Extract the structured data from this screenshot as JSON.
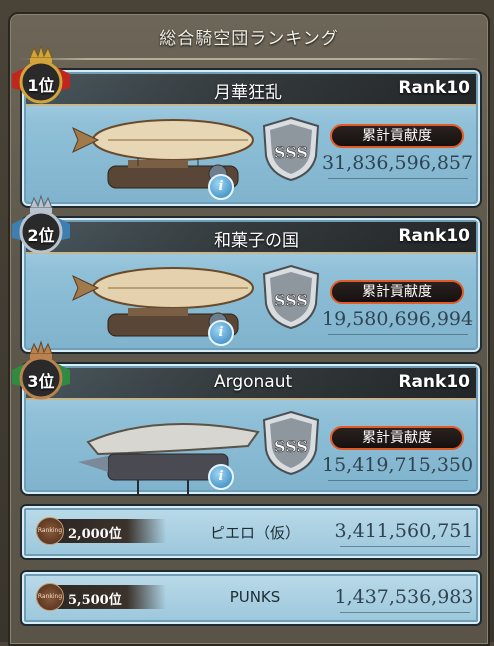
{
  "header": {
    "title": "総合騎空団ランキング"
  },
  "labels": {
    "contribution_badge": "累計貢献度",
    "grade": "SSS",
    "info_glyph": "i",
    "ranking_emblem": "Ranking"
  },
  "top_crews": [
    {
      "position": "1位",
      "name": "月華狂乱",
      "rank": "Rank10",
      "score": "31,836,596,857",
      "medal_color": "#d2a53a",
      "medal_ribbon": "#c0261e"
    },
    {
      "position": "2位",
      "name": "和菓子の国",
      "rank": "Rank10",
      "score": "19,580,696,994",
      "medal_color": "#b8c3cf",
      "medal_ribbon": "#3d7fb0"
    },
    {
      "position": "3位",
      "name": "Argonaut",
      "rank": "Rank10",
      "score": "15,419,715,350",
      "medal_color": "#b9824f",
      "medal_ribbon": "#2e8b3f"
    }
  ],
  "other_crews": [
    {
      "position": "2,000位",
      "name": "ピエロ（仮）",
      "score": "3,411,560,751"
    },
    {
      "position": "5,500位",
      "name": "PUNKS",
      "score": "1,437,536,983"
    }
  ]
}
